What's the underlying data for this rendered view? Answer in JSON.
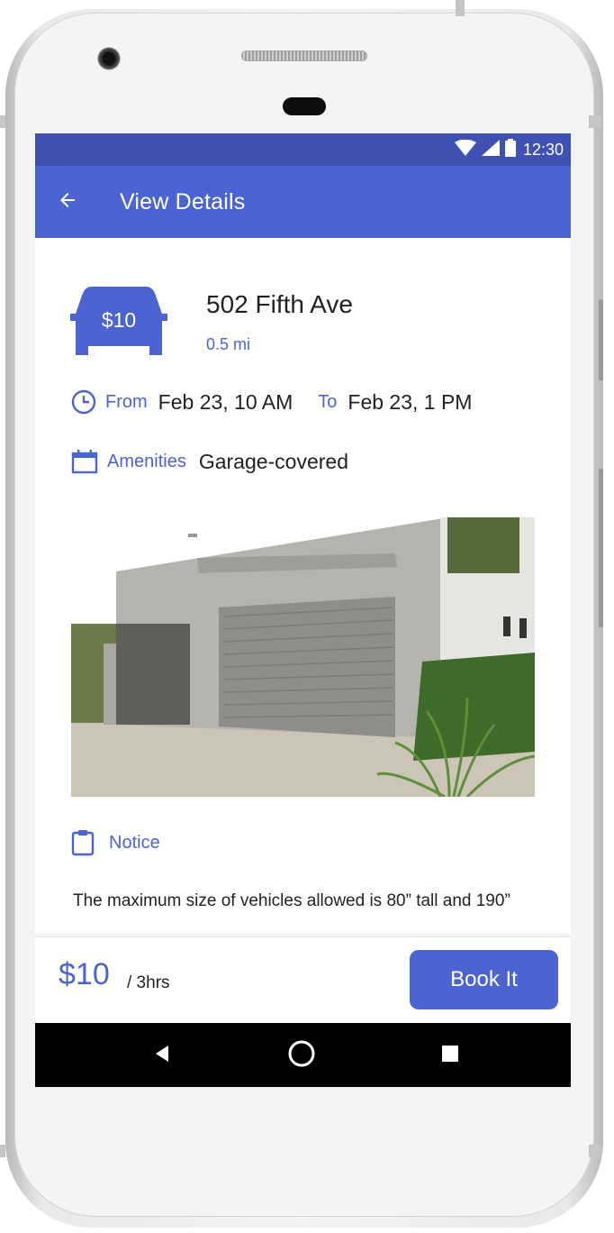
{
  "status_bar": {
    "time": "12:30"
  },
  "app_bar": {
    "title": "View Details"
  },
  "listing": {
    "price_badge": "$10",
    "address": "502 Fifth Ave",
    "distance": "0.5 mi",
    "from_label": "From",
    "from_value": "Feb 23, 10 AM",
    "to_label": "To",
    "to_value": "Feb 23, 1 PM",
    "amenities_label": "Amenities",
    "amenities_value": "Garage-covered",
    "notice_label": "Notice",
    "notice_text": "The maximum size of vehicles allowed is 80” tall and 190”"
  },
  "booking": {
    "price": "$10",
    "unit": "/ 3hrs",
    "book_label": "Book It"
  },
  "colors": {
    "primary": "#4c63d2",
    "status_bar": "#3f52b4",
    "nav_bar": "#000000"
  },
  "icons": [
    "back-arrow-icon",
    "wifi-icon",
    "signal-icon",
    "battery-icon",
    "car-icon",
    "clock-icon",
    "calendar-icon",
    "clipboard-icon",
    "nav-back-icon",
    "nav-home-icon",
    "nav-recents-icon"
  ]
}
